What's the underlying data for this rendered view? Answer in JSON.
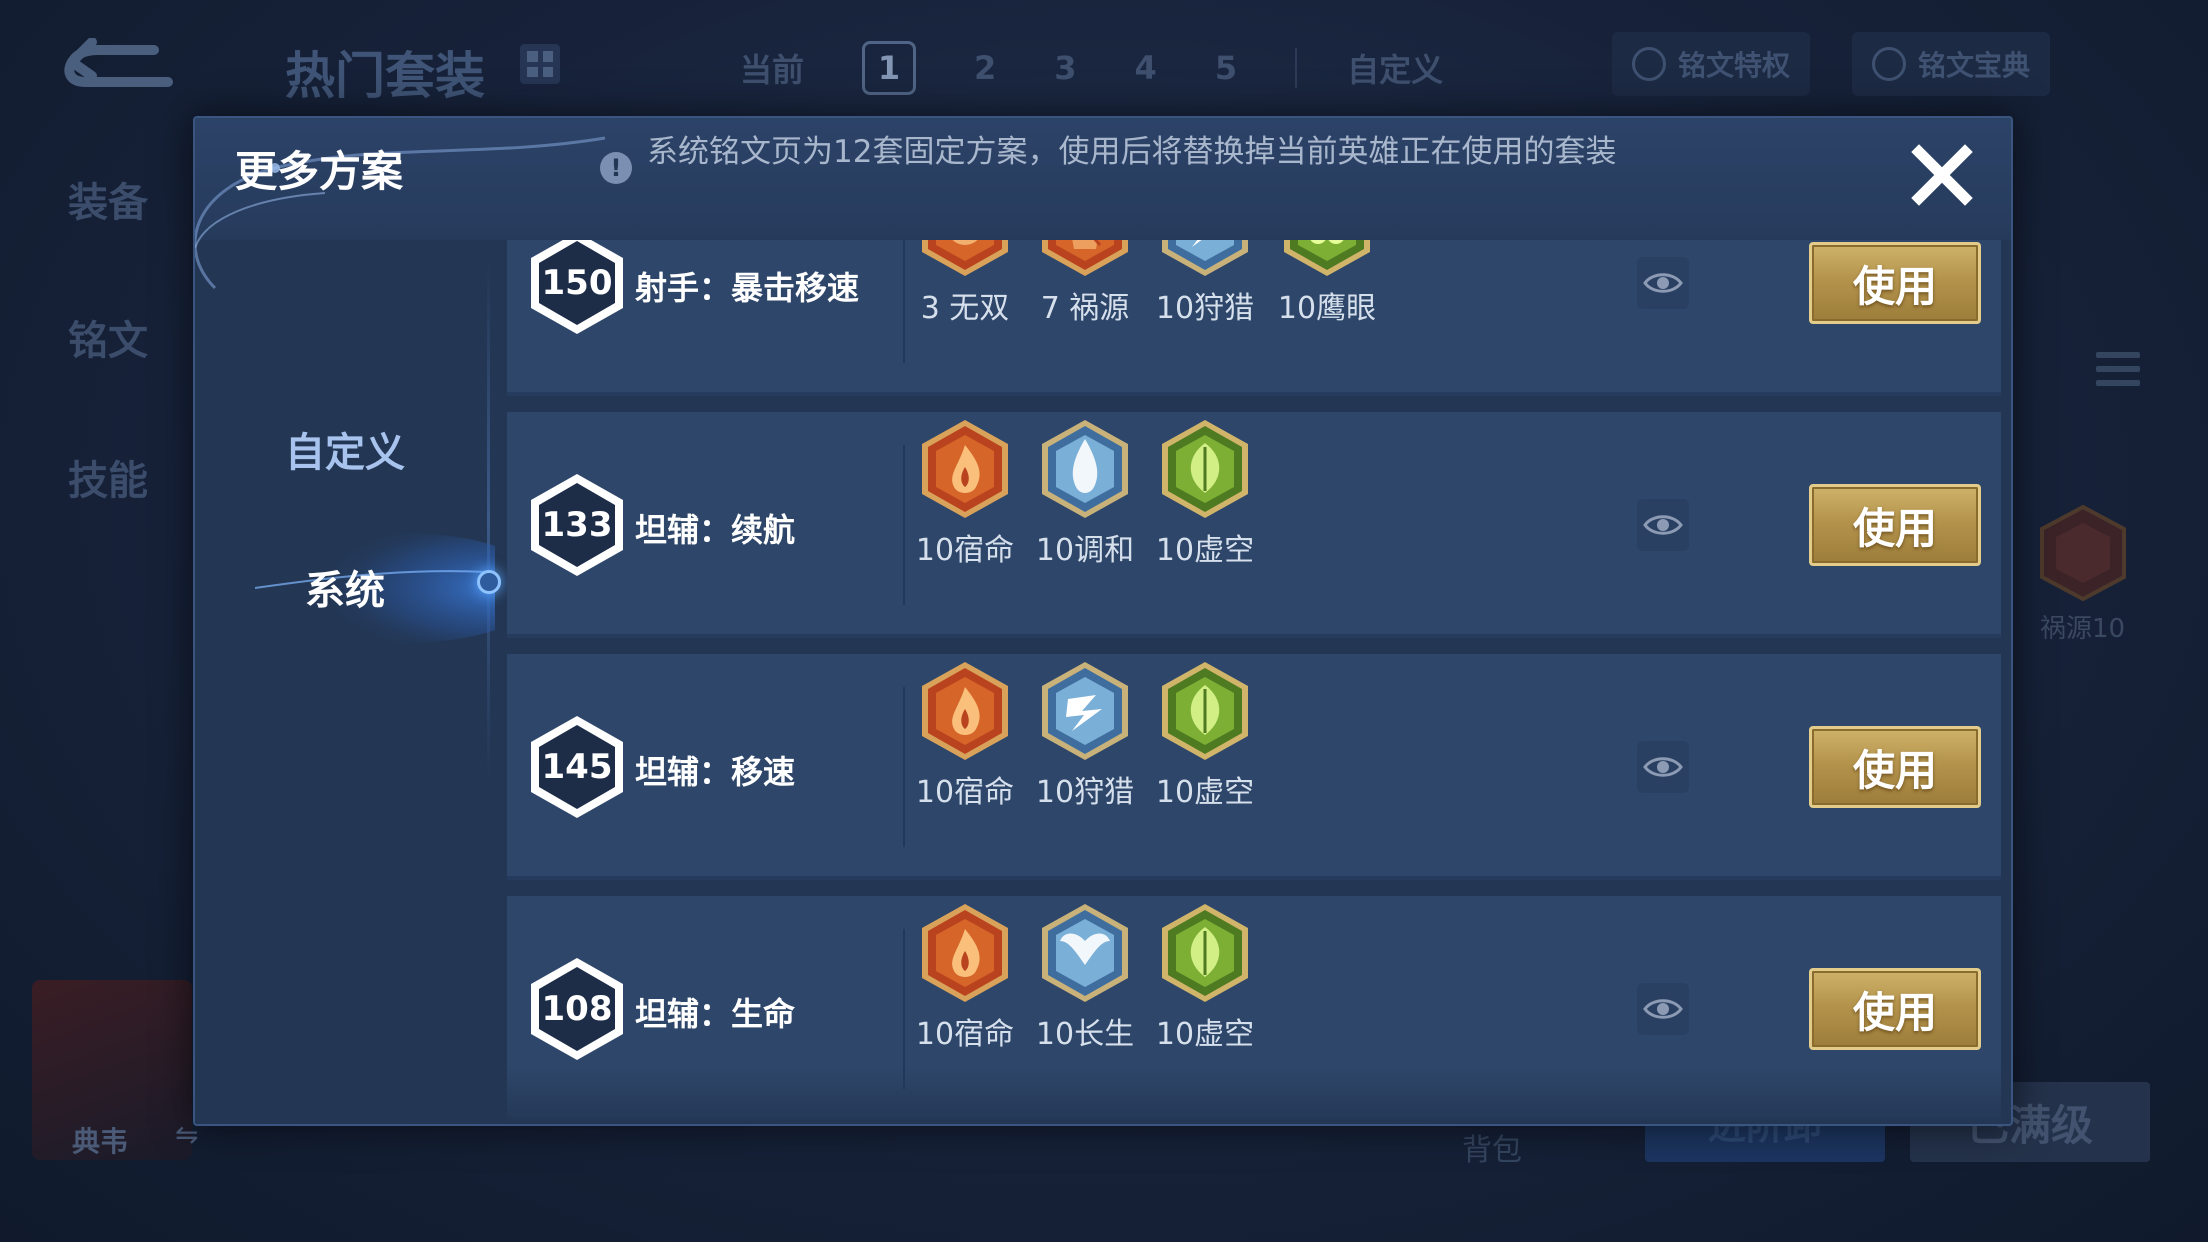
{
  "background": {
    "title": "热门套装",
    "tabs": [
      "当前",
      "1",
      "2",
      "3",
      "4",
      "5",
      "自定义"
    ],
    "top_buttons": [
      "铭文特权",
      "铭文宝典"
    ],
    "side_menu": [
      "装备",
      "铭文",
      "技能"
    ],
    "hero_name": "典韦",
    "swap_symbol": "⇋",
    "pack_label": "背包",
    "blue_button": "进阶卸",
    "grey_button": "已满级",
    "right_rune_label": "祸源10"
  },
  "modal": {
    "title": "更多方案",
    "info_text": "系统铭文页为12套固定方案，使用后将替换掉当前英雄正在使用的套装",
    "nav": {
      "custom": "自定义",
      "system": "系统"
    },
    "use_label": "使用",
    "rows": [
      {
        "level": "150",
        "name": "射手：暴击移速",
        "runes": [
          {
            "label": "3 无双",
            "color": "red",
            "icon": "rose-rune-icon"
          },
          {
            "label": "7 祸源",
            "color": "red",
            "icon": "shard-rune-icon"
          },
          {
            "label": "10狩猎",
            "color": "blue",
            "icon": "lightning-rune-icon"
          },
          {
            "label": "10鹰眼",
            "color": "green",
            "icon": "clover-rune-icon"
          }
        ]
      },
      {
        "level": "133",
        "name": "坦辅：续航",
        "runes": [
          {
            "label": "10宿命",
            "color": "red",
            "icon": "flame-rune-icon"
          },
          {
            "label": "10调和",
            "color": "blue",
            "icon": "droplet-rune-icon"
          },
          {
            "label": "10虚空",
            "color": "green",
            "icon": "leaf-rune-icon"
          }
        ]
      },
      {
        "level": "145",
        "name": "坦辅：移速",
        "runes": [
          {
            "label": "10宿命",
            "color": "red",
            "icon": "flame-rune-icon"
          },
          {
            "label": "10狩猎",
            "color": "blue",
            "icon": "lightning-rune-icon"
          },
          {
            "label": "10虚空",
            "color": "green",
            "icon": "leaf-rune-icon"
          }
        ]
      },
      {
        "level": "108",
        "name": "坦辅：生命",
        "runes": [
          {
            "label": "10宿命",
            "color": "red",
            "icon": "flame-rune-icon"
          },
          {
            "label": "10长生",
            "color": "blue",
            "icon": "wings-rune-icon"
          },
          {
            "label": "10虚空",
            "color": "green",
            "icon": "leaf-rune-icon"
          }
        ]
      }
    ]
  },
  "colors": {
    "gold": "#c4a45c",
    "panel": "#2d4669",
    "modal": "#233653"
  }
}
